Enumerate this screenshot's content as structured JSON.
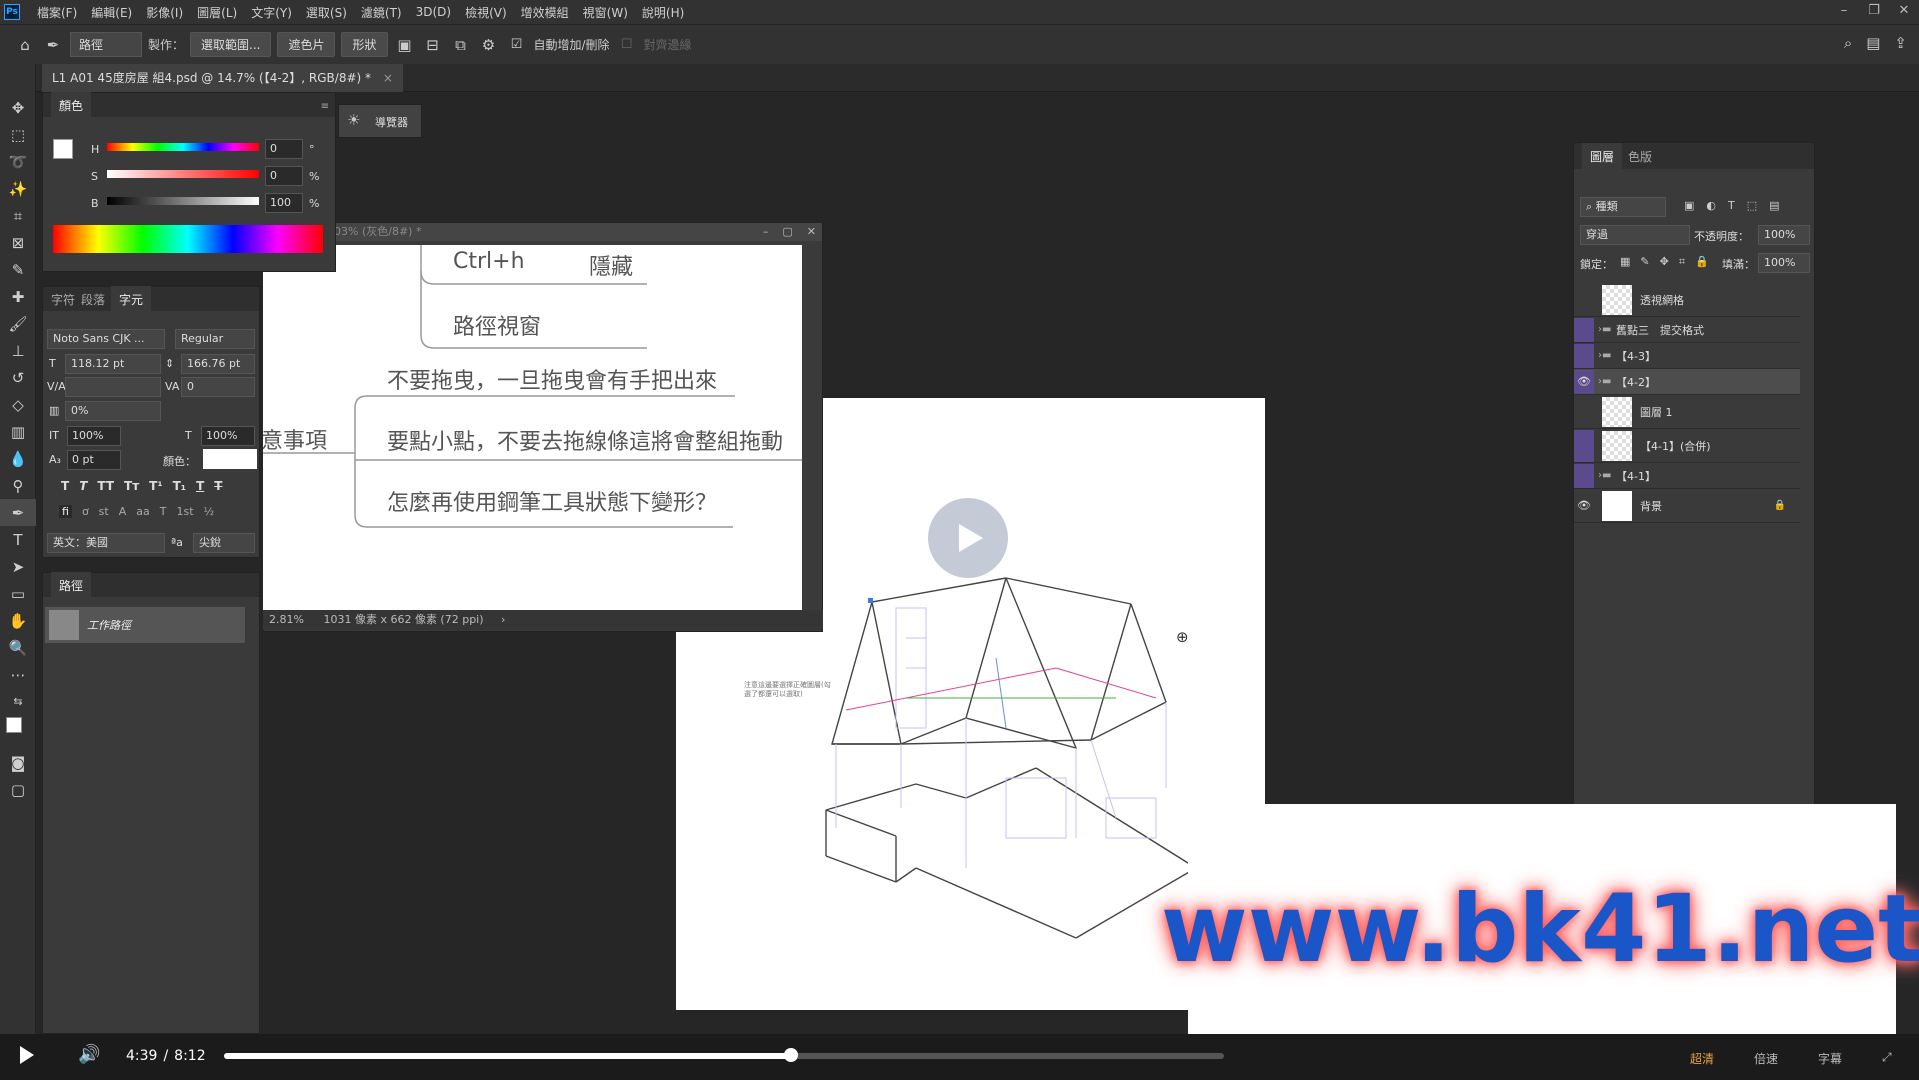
{
  "menu": [
    "檔案(F)",
    "編輯(E)",
    "影像(I)",
    "圖層(L)",
    "文字(Y)",
    "選取(S)",
    "濾鏡(T)",
    "3D(D)",
    "檢視(V)",
    "增效模組",
    "視窗(W)",
    "說明(H)"
  ],
  "options": {
    "mode": "路徑",
    "make_label": "製作：",
    "selection_btn": "選取範圍...",
    "mask_btn": "遮色片",
    "shape_btn": "形狀",
    "auto_add": "自動增加/刪除",
    "align_edges": "對齊邊緣"
  },
  "document_tab": "L1 A01 45度房屋 組4.psd @ 14.7% (【4-2】, RGB/8#) *",
  "color_panel": {
    "tab": "顏色",
    "h_label": "H",
    "h_value": "0",
    "h_unit": "°",
    "s_label": "S",
    "s_value": "0",
    "s_unit": "%",
    "b_label": "B",
    "b_value": "100",
    "b_unit": "%"
  },
  "navigator": {
    "label": "導覽器"
  },
  "char_panel": {
    "tabs": [
      "字符",
      "段落",
      "字元"
    ],
    "font": "Noto Sans CJK ...",
    "style": "Regular",
    "size": "118.12 pt",
    "leading": "166.76 pt",
    "tracking": "0",
    "scale_pct": "0%",
    "vscale": "100%",
    "hscale": "100%",
    "baseline": "0 pt",
    "color_label": "顏色：",
    "language": "英文：美國",
    "aa_label": "ªa",
    "antialias": "尖銳",
    "type_styles": [
      "T",
      "T",
      "TT",
      "Tт",
      "T¹",
      "T₁",
      "T",
      "T"
    ],
    "opentype": [
      "fi",
      "ơ",
      "st",
      "A",
      "aa",
      "T",
      "1st",
      "½"
    ]
  },
  "paths_panel": {
    "tab": "路徑",
    "item": "工作路徑"
  },
  "doc_window": {
    "title": "03% (灰色/8#) *",
    "zoom": "2.81%",
    "dimensions": "1031 像素 x 662 像素 (72 ppi)",
    "mindmap": {
      "item1_key": "Ctrl+h",
      "item1_val": "隱藏",
      "item2": "路徑視窗",
      "side": "意事項",
      "note1": "不要拖曳，一旦拖曳會有手把出來",
      "note2": "要點小點，不要去拖線條這將會整組拖動",
      "note3": "怎麼再使用鋼筆工具狀態下變形？"
    }
  },
  "artboard": {
    "annotation": "注意這邊要選擇正確圖層(勾選了都還可以選取)"
  },
  "layers_panel": {
    "tabs": [
      "圖層",
      "色版"
    ],
    "filter": "種類",
    "blend": "穿過",
    "opacity_label": "不透明度：",
    "opacity": "100%",
    "lock_label": "鎖定：",
    "fill_label": "填滿：",
    "fill": "100%",
    "layers": [
      {
        "name": "透視網格",
        "type": "layer",
        "visible": false,
        "color": ""
      },
      {
        "name": "舊點三　提交格式",
        "type": "group",
        "visible": false,
        "color": "#5b4a8c"
      },
      {
        "name": "【4-3】",
        "type": "group",
        "visible": false,
        "color": "#5b4a8c"
      },
      {
        "name": "【4-2】",
        "type": "group",
        "visible": true,
        "color": "#5b4a8c"
      },
      {
        "name": "圖層 1",
        "type": "layer",
        "visible": false,
        "color": ""
      },
      {
        "name": "【4-1】(合併)",
        "type": "layer",
        "visible": false,
        "color": "#5b4a8c"
      },
      {
        "name": "【4-1】",
        "type": "group",
        "visible": false,
        "color": "#5b4a8c"
      },
      {
        "name": "背景",
        "type": "layer",
        "visible": true,
        "color": "",
        "locked": true
      }
    ]
  },
  "watermark": "www.bk41.net",
  "video": {
    "current": "4:39",
    "separator": "/",
    "total": "8:12",
    "progress_fraction": 0.567,
    "right_items": [
      "超清",
      "倍速",
      "字幕"
    ]
  }
}
